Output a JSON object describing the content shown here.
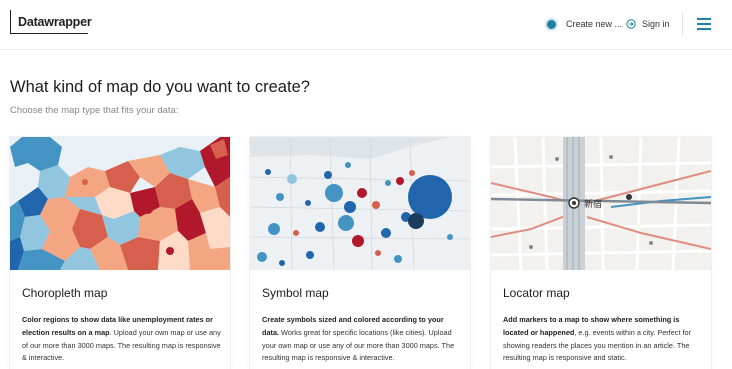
{
  "header": {
    "logo": "Datawrapper",
    "create_label": "Create new ...",
    "signin_label": "Sign in",
    "accent": "#1d81a2"
  },
  "main": {
    "title": "What kind of map do you want to create?",
    "subtitle": "Choose the map type that fits your data:"
  },
  "cards": [
    {
      "title": "Choropleth map",
      "desc_bold": "Color regions to show data like unemployment rates or election results on a map",
      "desc_rest": ". Upload your own map or use any of our more than 3000 maps. The resulting map is responsive & interactive."
    },
    {
      "title": "Symbol map",
      "desc_bold": "Create symbols sized and colored according to your data.",
      "desc_rest": " Works great for specific locations (like cities). Upload your own map or use any of our more than 3000 maps. The resulting map is responsive & interactive."
    },
    {
      "title": "Locator map",
      "desc_bold": "Add markers to a map to show where something is located or happened",
      "desc_rest": ", e.g. events within a city. Perfect for showing readers the places you mention in an article. The resulting map is responsive and static."
    }
  ],
  "locator_labels": {
    "station": "新宿"
  },
  "colors": {
    "red_dark": "#b2182b",
    "red_mid": "#d6604d",
    "red_light": "#f4a582",
    "blue_light": "#92c5de",
    "blue_mid": "#4393c3",
    "blue_dark": "#2166ac",
    "map_bg": "#dfe4e8"
  }
}
